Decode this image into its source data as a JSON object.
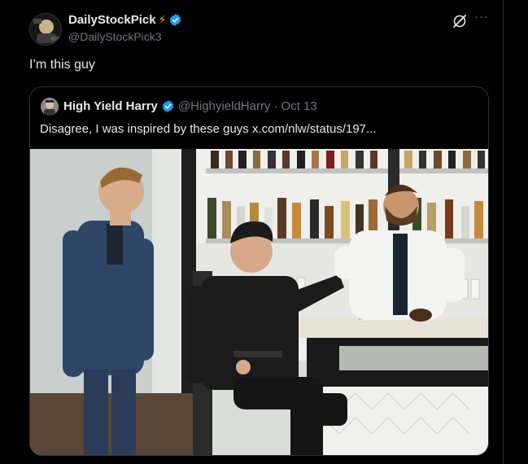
{
  "post": {
    "display_name": "DailyStockPick",
    "emoji": "⚡",
    "handle": "@DailyStockPick3",
    "text": "I’m this guy",
    "more_label": "···"
  },
  "quote": {
    "display_name": "High Yield Harry",
    "handle": "@HighyieldHarry",
    "separator": "·",
    "date": "Oct 13",
    "text": "Disagree, I was inspired by these guys  x.com/nlw/status/197..."
  },
  "colors": {
    "background": "#000000",
    "text_primary": "#e7e9ea",
    "text_secondary": "#71767b",
    "border": "#2f3336",
    "verified_blue": "#1d9bf0",
    "bolt": "#f5b300"
  },
  "icons": [
    "verified-badge-icon",
    "grok-icon",
    "more-icon",
    "lightning-bolt-icon"
  ]
}
